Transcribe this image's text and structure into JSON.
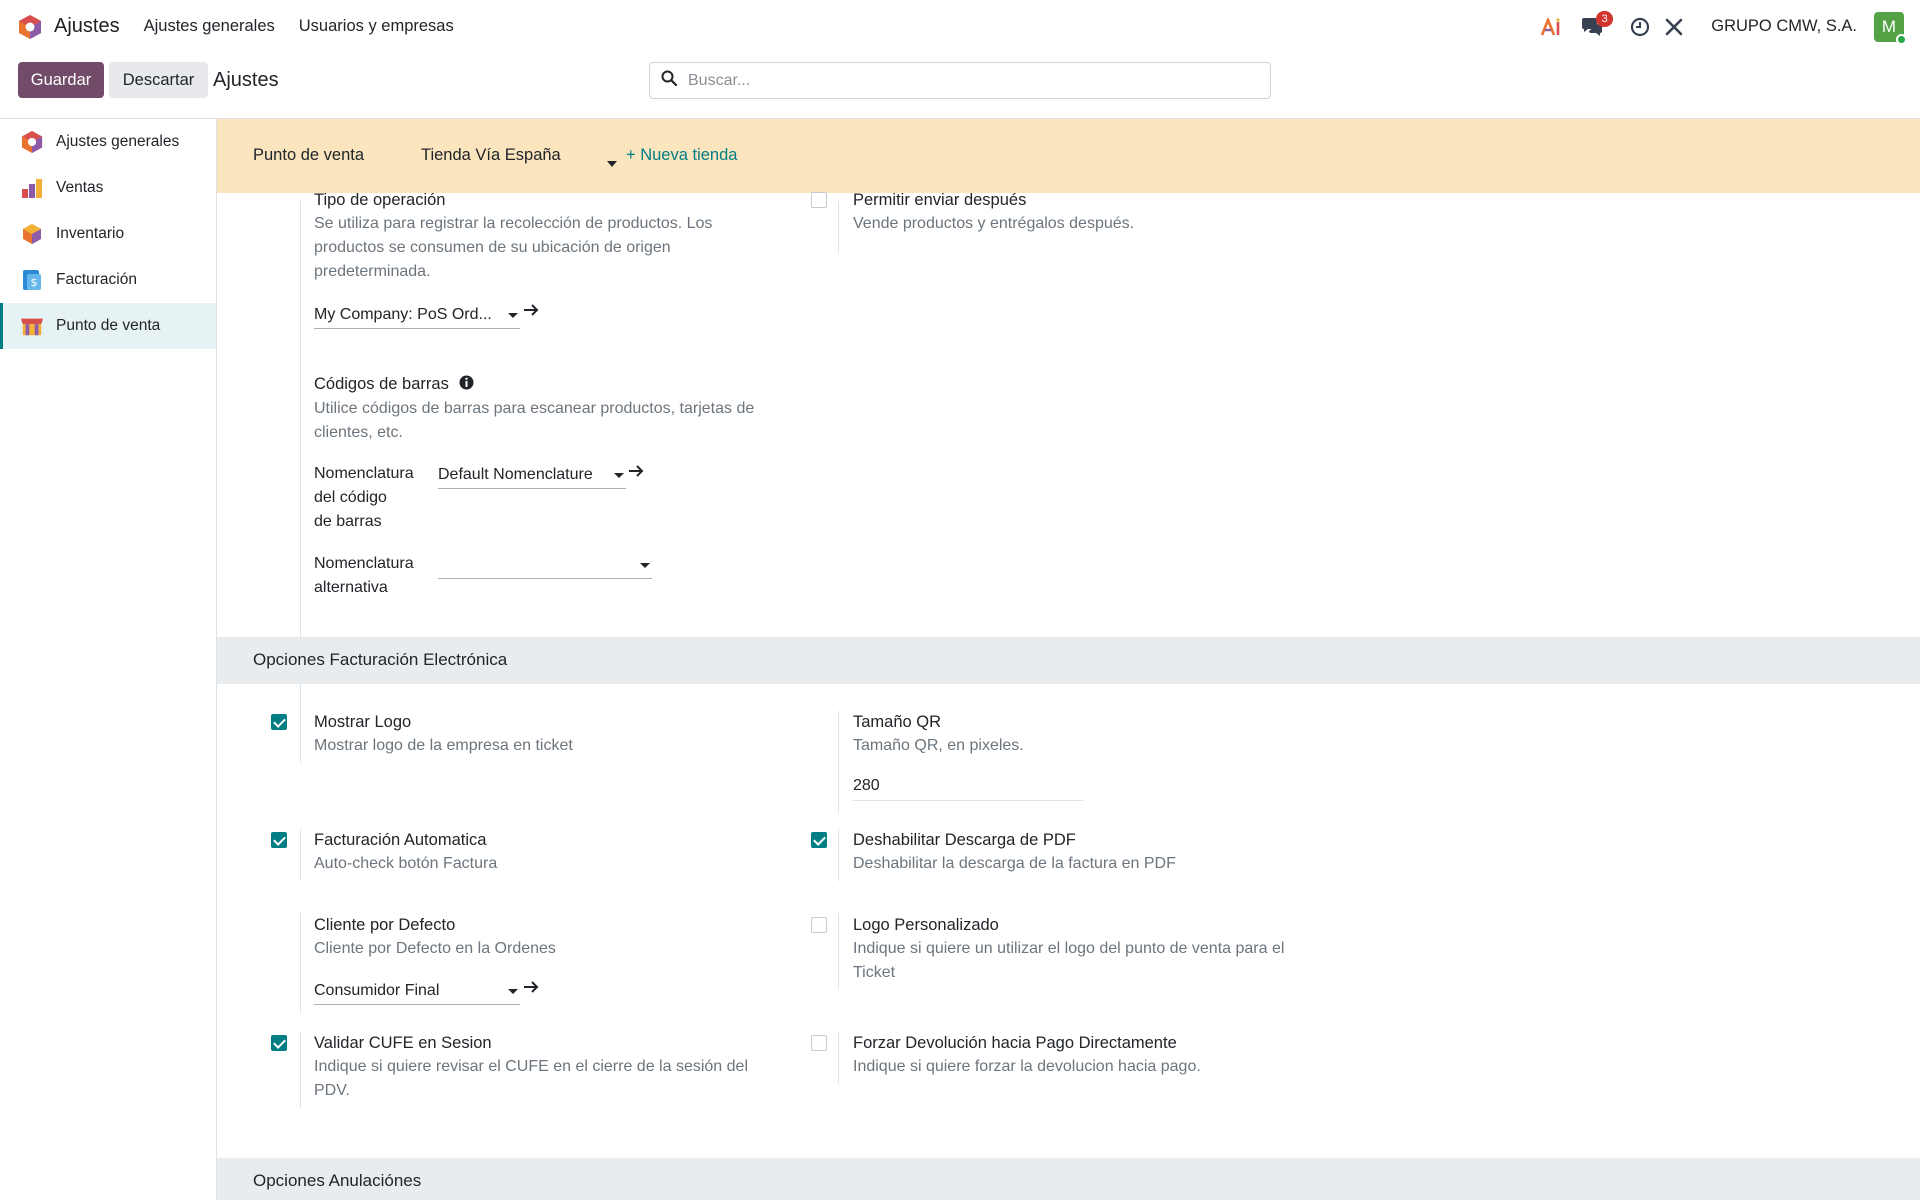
{
  "navbar": {
    "app_name": "Ajustes",
    "menu": [
      "Ajustes generales",
      "Usuarios y empresas"
    ],
    "messages_badge": "3",
    "company": "GRUPO CMW, S.A.",
    "avatar_initial": "M",
    "icons": [
      "ai-icon",
      "chat-icon",
      "clock-icon",
      "tools-icon"
    ]
  },
  "control": {
    "save_label": "Guardar",
    "discard_label": "Descartar",
    "title": "Ajustes",
    "search_placeholder": "Buscar..."
  },
  "sidebar": {
    "items": [
      {
        "label": "Ajustes generales",
        "icon": "settings-app-icon"
      },
      {
        "label": "Ventas",
        "icon": "sales-app-icon"
      },
      {
        "label": "Inventario",
        "icon": "inventory-app-icon"
      },
      {
        "label": "Facturación",
        "icon": "invoicing-app-icon"
      },
      {
        "label": "Punto de venta",
        "icon": "pos-app-icon",
        "active": true
      }
    ]
  },
  "pos_bar": {
    "label": "Punto de venta",
    "selected_store": "Tienda Vía España",
    "new_store": "+ Nueva tienda"
  },
  "operation_type": {
    "title": "Tipo de operación",
    "desc_1": "Se utiliza para registrar la recolección de productos. Los",
    "desc_2": "productos se consumen de su ubicación de origen",
    "desc_3": "predeterminada.",
    "value": "My Company: PoS Ord..."
  },
  "ship_later": {
    "title": "Permitir enviar después",
    "desc": "Vende productos y entrégalos después.",
    "checked": false
  },
  "barcodes": {
    "title": "Códigos de barras",
    "desc_1": "Utilice códigos de barras para escanear productos, tarjetas de",
    "desc_2": "clientes, etc.",
    "nomenclature_label_1": "Nomenclatura",
    "nomenclature_label_2": "del código",
    "nomenclature_label_3": "de barras",
    "nomenclature_value": "Default Nomenclature",
    "alt_label_1": "Nomenclatura",
    "alt_label_2": "alternativa",
    "alt_value": ""
  },
  "section_einvoice": {
    "title": "Opciones Facturación Electrónica"
  },
  "show_logo": {
    "title": "Mostrar Logo",
    "desc": "Mostrar logo de la empresa en ticket",
    "checked": true
  },
  "qr_size": {
    "title": "Tamaño QR",
    "desc": "Tamaño QR, en pixeles.",
    "value": "280"
  },
  "auto_invoice": {
    "title": "Facturación Automatica",
    "desc": "Auto-check botón Factura",
    "checked": true
  },
  "disable_pdf": {
    "title": "Deshabilitar Descarga de PDF",
    "desc": "Deshabilitar la descarga de la factura en PDF",
    "checked": true
  },
  "default_customer": {
    "title": "Cliente por Defecto",
    "desc": "Cliente por Defecto en la Ordenes",
    "value": "Consumidor Final"
  },
  "custom_logo": {
    "title": "Logo Personalizado",
    "desc_1": "Indique si quiere un utilizar el logo del punto de venta para el",
    "desc_2": "Ticket",
    "checked": false
  },
  "validate_cufe": {
    "title": "Validar CUFE en Sesion",
    "desc_1": "Indique si quiere revisar el CUFE en el cierre de la sesión del",
    "desc_2": "PDV.",
    "checked": true
  },
  "force_refund": {
    "title": "Forzar Devolución hacia Pago Directamente",
    "desc": "Indique si quiere forzar la devolucion hacia pago.",
    "checked": false
  },
  "section_cancel": {
    "title": "Opciones Anulaciónes"
  },
  "colors": {
    "primary": "#714b67",
    "accent": "#017e84",
    "banner": "#fae5bf"
  }
}
